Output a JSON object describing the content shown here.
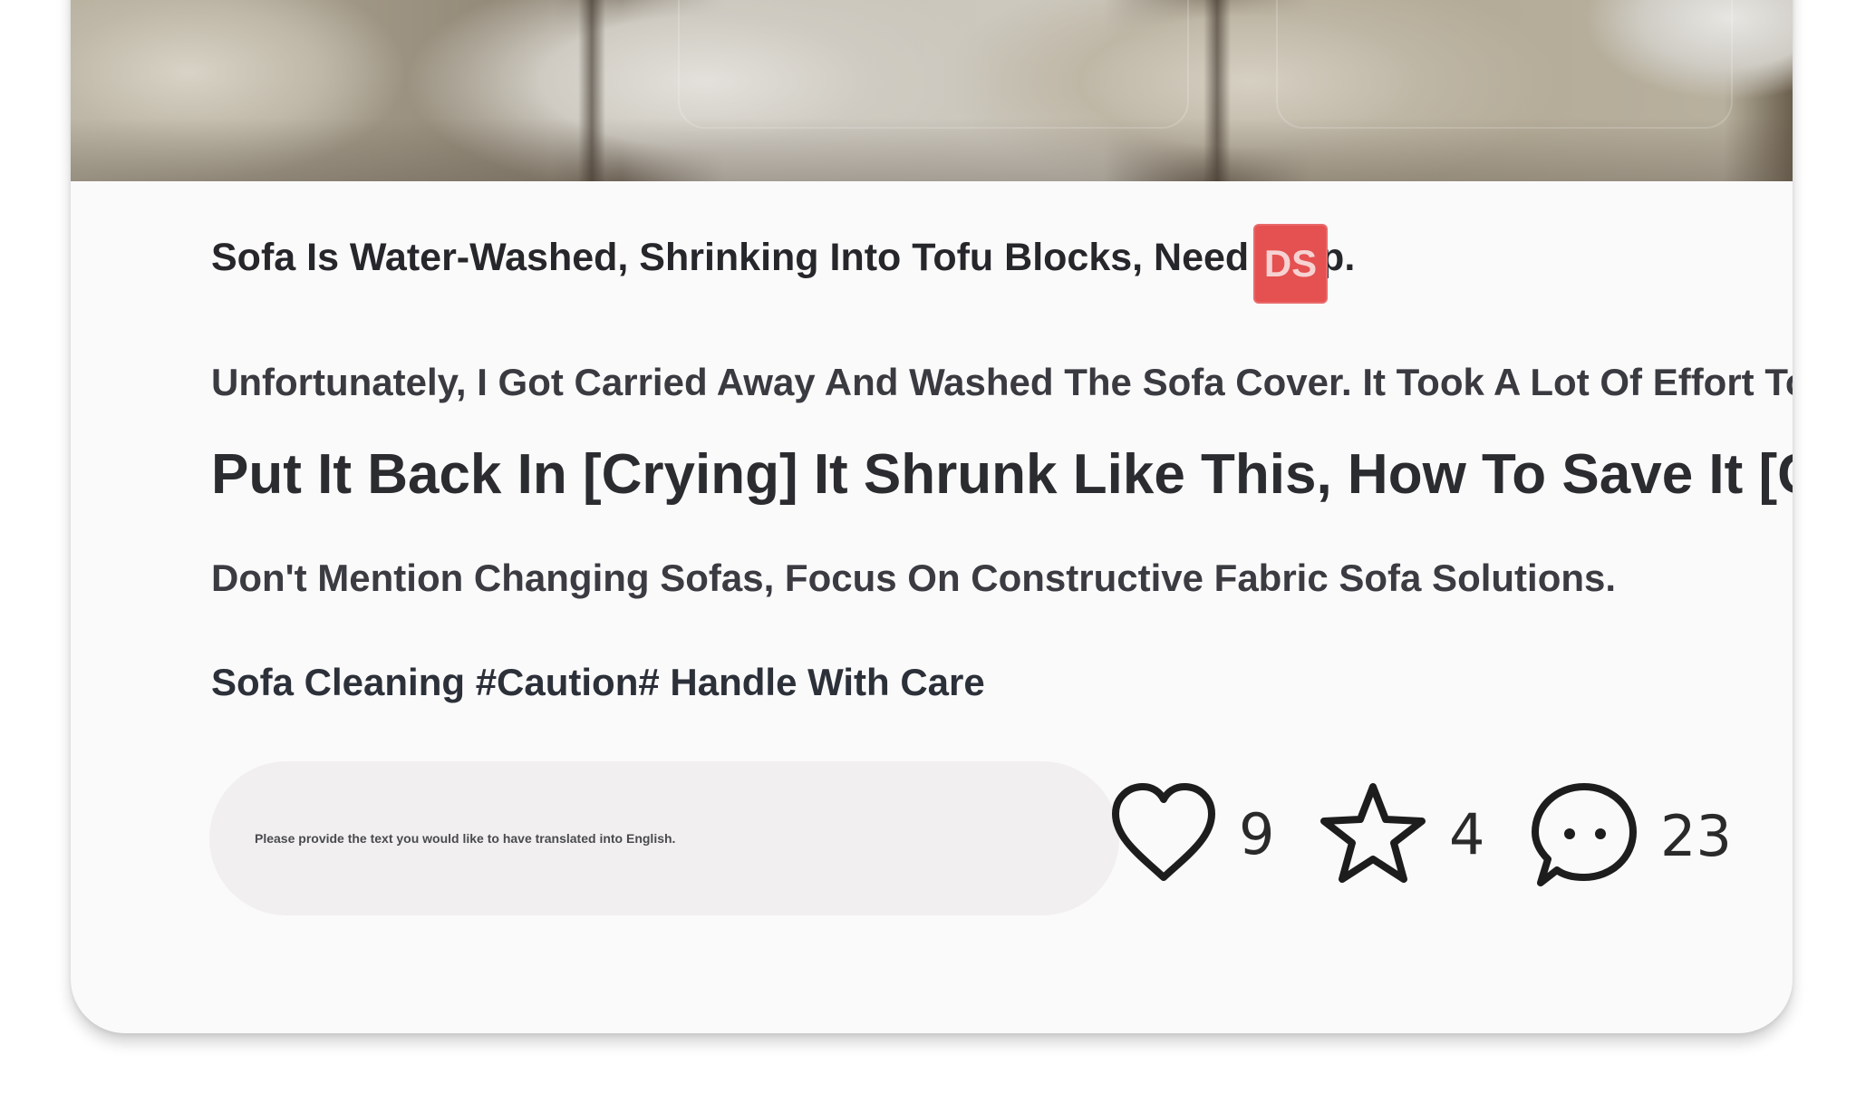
{
  "post": {
    "title": "Sofa Is Water-Washed, Shrinking Into Tofu Blocks, Need Help.",
    "badge_text": "DS",
    "body_line_1": "Unfortunately, I Got Carried Away And Washed The Sofa Cover. It Took A Lot Of Effort To Do So.",
    "body_line_2": "Put It Back In [Crying] It Shrunk Like This, How To Save It [Cover Face]",
    "body_line_3": "Don't Mention Changing Sofas, Focus On Constructive Fabric Sofa Solutions.",
    "tags_line": "Sofa Cleaning #Caution# Handle With Care"
  },
  "comment_box": {
    "placeholder": "Please provide the text you would like to have translated into English."
  },
  "actions": {
    "likes": "9",
    "favorites": "4",
    "comments": "23",
    "icons": [
      "heart-icon",
      "star-icon",
      "comment-icon"
    ]
  },
  "colors": {
    "badge": "#e55050",
    "card_background": "#fbfafb",
    "input_background": "#f1eff0"
  }
}
